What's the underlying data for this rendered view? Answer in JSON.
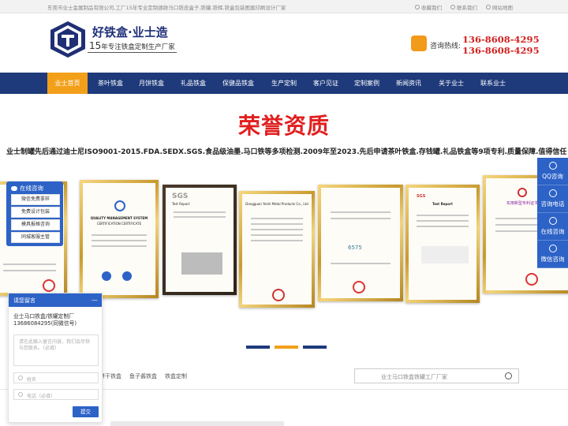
{
  "topbar": {
    "intro": "东莞市业士金属制品有限公司,工厂15年专业定制挪款马口铁皮盒子,铁罐,铁辉,铁盒包装图案印刷设计厂家",
    "links": [
      "收藏我们",
      "联系我们",
      "网站地图"
    ]
  },
  "header": {
    "brand": "好铁盒·业士造",
    "slogan_num": "15",
    "slogan_text": "年专注铁盒定制生产厂家",
    "phone_label": "咨询热线:",
    "phones": [
      "136-8608-4295",
      "136-8608-4295"
    ]
  },
  "nav": {
    "items": [
      "业士首页",
      "茶叶铁盒",
      "月饼铁盒",
      "礼品铁盒",
      "保健品铁盒",
      "生产定制",
      "客户见证",
      "定制案例",
      "新闻资讯",
      "关于业士",
      "联系业士"
    ],
    "active": "业士首页"
  },
  "honor": {
    "title": "荣誉资质",
    "description": "业士制罐先后通过迪士尼ISO9001-2015.FDA.SEDX.SGS.食品级油墨.马口铁等多项检测.2009年至2023.先后申请茶叶铁盒.存钱罐.礼品铁盒等9项专利.质量保障.值得信任"
  },
  "certificates": [
    {
      "heading": "",
      "subheading": ""
    },
    {
      "heading": "QUALITY MANAGEMENT SYSTEM",
      "subheading": "CERTIFICATION CERTIFICATE"
    },
    {
      "heading": "SGS",
      "subheading": "Test Report"
    },
    {
      "heading": "",
      "subheading": "Dongguan Yeshi Metal Products Co., Ltd"
    },
    {
      "heading": "",
      "subheading": "6575"
    },
    {
      "heading": "SGS",
      "subheading": "Test Report"
    },
    {
      "heading": "",
      "subheading": "实用新型专利证书"
    }
  ],
  "carousel": {
    "slides": 3,
    "active": 1
  },
  "bottom": {
    "tabs": [
      "饼干铁盒",
      "鱼子酱铁盒",
      "铁盒定制"
    ],
    "search_placeholder": "业士马口铁盒铁罐工厂厂家"
  },
  "chat": {
    "title": "在线咨询",
    "items": [
      "微信免费拿样",
      "免费设计包装",
      "模具报格咨询",
      "同城客服主管"
    ]
  },
  "form": {
    "title": "请您留言",
    "minimize": "—",
    "company": "业士马口铁盒/铁罐定制厂",
    "company_phone": "13686084295(同微信号)",
    "message_placeholder": "请在此输入留言内容，我们会尽快与您联系。（必填）",
    "name_placeholder": "姓名",
    "phone_placeholder": "电话（必填）",
    "submit": "提交"
  },
  "sidebar": {
    "items": [
      "QQ咨询",
      "咨询电话",
      "在线咨询",
      "微信咨询"
    ]
  },
  "colors": {
    "nav_bg": "#1e3a7b",
    "accent": "#f2a01a",
    "title_red": "#e11f1f",
    "phone_red": "#d2201f",
    "widget_blue": "#2d62c7"
  }
}
